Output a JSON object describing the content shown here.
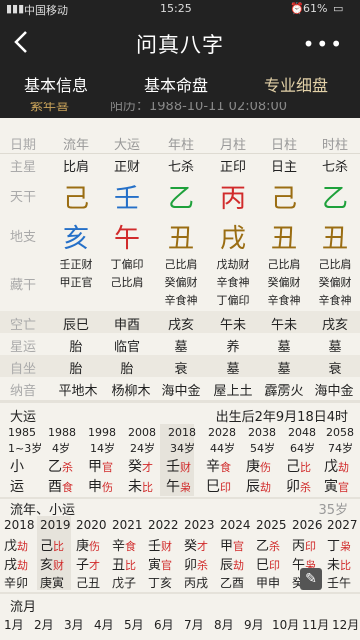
{
  "status": {
    "carrier": "中国移动",
    "time": "15:25",
    "battery": "61%"
  },
  "header": {
    "title": "问真八字",
    "more": "•••"
  },
  "tabs": [
    {
      "label": "基本信息"
    },
    {
      "label": "基本命盘"
    },
    {
      "label": "专业细盘"
    }
  ],
  "subbar": {
    "left": "紫年喜",
    "right": "阳历：1988-10-11 02:08:00"
  },
  "columns": {
    "label": "日期",
    "names": [
      "流年",
      "大运",
      "年柱",
      "月柱",
      "日柱",
      "时柱"
    ]
  },
  "zhuxing": {
    "label": "主星",
    "values": [
      "比肩",
      "正财",
      "七杀",
      "正印",
      "日主",
      "七杀"
    ]
  },
  "tiangan": {
    "label": "天干",
    "values": [
      "己",
      "壬",
      "乙",
      "丙",
      "己",
      "乙"
    ]
  },
  "dizhi": {
    "label": "地支",
    "values": [
      "亥",
      "午",
      "丑",
      "戌",
      "丑",
      "丑"
    ]
  },
  "canggan": {
    "label": "藏干",
    "cols": [
      [
        "壬正财",
        "甲正官"
      ],
      [
        "丁偏印",
        "己比肩"
      ],
      [
        "己比肩",
        "癸偏财",
        "辛食神"
      ],
      [
        "戊劫财",
        "辛食神",
        "丁偏印"
      ],
      [
        "己比肩",
        "癸偏财",
        "辛食神"
      ],
      [
        "己比肩",
        "癸偏财",
        "辛食神"
      ]
    ]
  },
  "kongwang": {
    "label": "空亡",
    "values": [
      "辰巳",
      "申酉",
      "戌亥",
      "午未",
      "午未",
      "戌亥"
    ]
  },
  "xingyun": {
    "label": "星运",
    "values": [
      "胎",
      "临官",
      "墓",
      "养",
      "墓",
      "墓"
    ]
  },
  "zizuo": {
    "label": "自坐",
    "values": [
      "胎",
      "胎",
      "衰",
      "墓",
      "墓",
      "衰"
    ]
  },
  "nayin": {
    "label": "纳音",
    "values": [
      "平地木",
      "杨柳木",
      "海中金",
      "屋上土",
      "霹雳火",
      "海中金"
    ]
  },
  "dayun": {
    "title": "大运",
    "info": "出生后2年9月18日4时",
    "years": [
      "1985",
      "1988",
      "1998",
      "2008",
      "2018",
      "2028",
      "2038",
      "2048",
      "2058"
    ],
    "ages": [
      "1~3岁",
      "4岁",
      "14岁",
      "24岁",
      "34岁",
      "44岁",
      "54岁",
      "64岁",
      "74岁"
    ],
    "gan": [
      [
        "小",
        ""
      ],
      [
        "乙",
        "杀"
      ],
      [
        "甲",
        "官"
      ],
      [
        "癸",
        "才"
      ],
      [
        "壬",
        "财"
      ],
      [
        "辛",
        "食"
      ],
      [
        "庚",
        "伤"
      ],
      [
        "己",
        "比"
      ],
      [
        "戊",
        "劫"
      ]
    ],
    "zhi": [
      [
        "运",
        ""
      ],
      [
        "酉",
        "食"
      ],
      [
        "申",
        "伤"
      ],
      [
        "未",
        "比"
      ],
      [
        "午",
        "枭"
      ],
      [
        "巳",
        "印"
      ],
      [
        "辰",
        "劫"
      ],
      [
        "卯",
        "杀"
      ],
      [
        "寅",
        "官"
      ]
    ]
  },
  "liunian": {
    "title": "流年、小运",
    "age": "35岁",
    "years": [
      "2018",
      "2019",
      "2020",
      "2021",
      "2022",
      "2023",
      "2024",
      "2025",
      "2026",
      "2027"
    ],
    "gan": [
      [
        "戊",
        "劫"
      ],
      [
        "己",
        "比"
      ],
      [
        "庚",
        "伤"
      ],
      [
        "辛",
        "食"
      ],
      [
        "壬",
        "财"
      ],
      [
        "癸",
        "才"
      ],
      [
        "甲",
        "官"
      ],
      [
        "乙",
        "杀"
      ],
      [
        "丙",
        "印"
      ],
      [
        "丁",
        "枭"
      ]
    ],
    "zhi": [
      [
        "戌",
        "劫"
      ],
      [
        "亥",
        "财"
      ],
      [
        "子",
        "才"
      ],
      [
        "丑",
        "比"
      ],
      [
        "寅",
        "官"
      ],
      [
        "卯",
        "杀"
      ],
      [
        "辰",
        "劫"
      ],
      [
        "巳",
        "印"
      ],
      [
        "午",
        "枭"
      ],
      [
        "未",
        "比"
      ]
    ],
    "xiaoyun": [
      "辛卯",
      "庚寅",
      "己丑",
      "戊子",
      "丁亥",
      "丙戌",
      "乙酉",
      "甲申",
      "癸未",
      "壬午"
    ]
  },
  "liuyue": {
    "title": "流月",
    "months": [
      "1月",
      "2月",
      "3月",
      "4月",
      "5月",
      "6月",
      "7月",
      "8月",
      "9月",
      "10月",
      "11月",
      "12月"
    ]
  }
}
